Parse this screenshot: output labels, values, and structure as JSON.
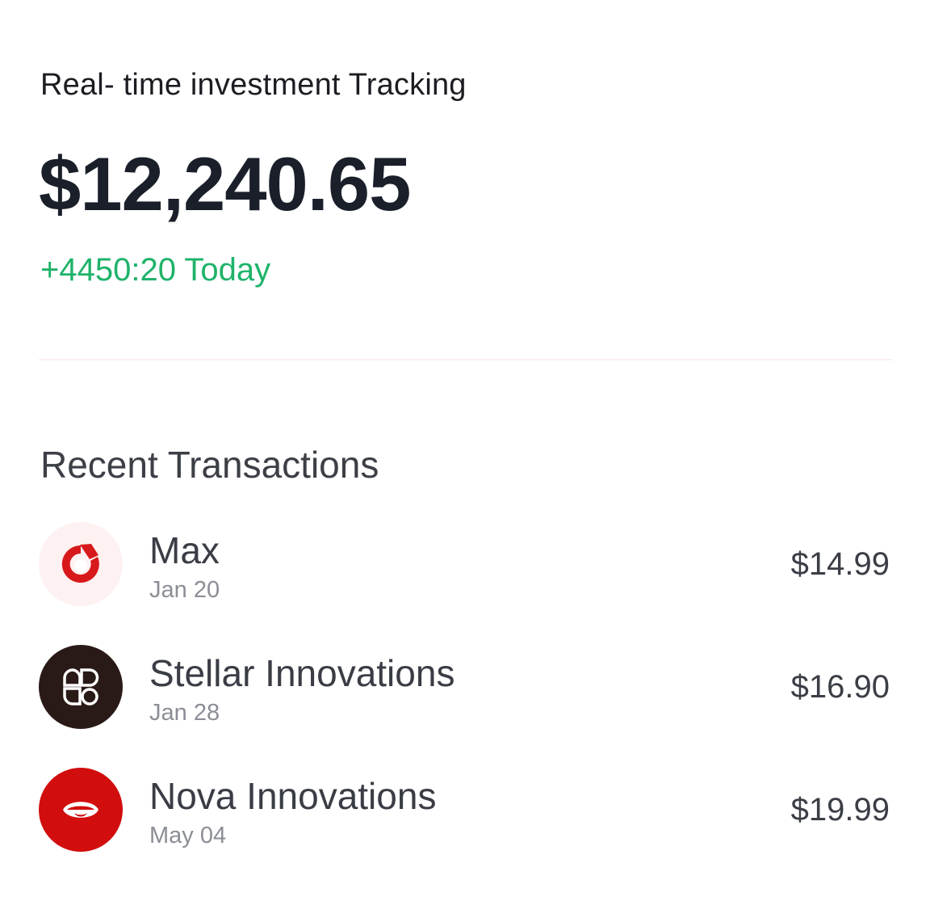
{
  "header": {
    "subtitle": "Real- time investment Tracking",
    "balance": "$12,240.65",
    "change": "+4450:20 Today"
  },
  "colors": {
    "positive": "#1fb36a",
    "max_logo_bg": "#fdf1f1",
    "max_logo_fg": "#d8191c",
    "stellar_logo_bg": "#2a1a17",
    "nova_logo_bg": "#d10d0d"
  },
  "transactions": {
    "title": "Recent Transactions",
    "items": [
      {
        "name": "Max",
        "date": "Jan 20",
        "amount": "$14.99",
        "icon": "max-logo-icon"
      },
      {
        "name": "Stellar Innovations",
        "date": "Jan 28",
        "amount": "$16.90",
        "icon": "stellar-logo-icon"
      },
      {
        "name": "Nova Innovations",
        "date": "May 04",
        "amount": "$19.99",
        "icon": "nova-logo-icon"
      }
    ]
  }
}
